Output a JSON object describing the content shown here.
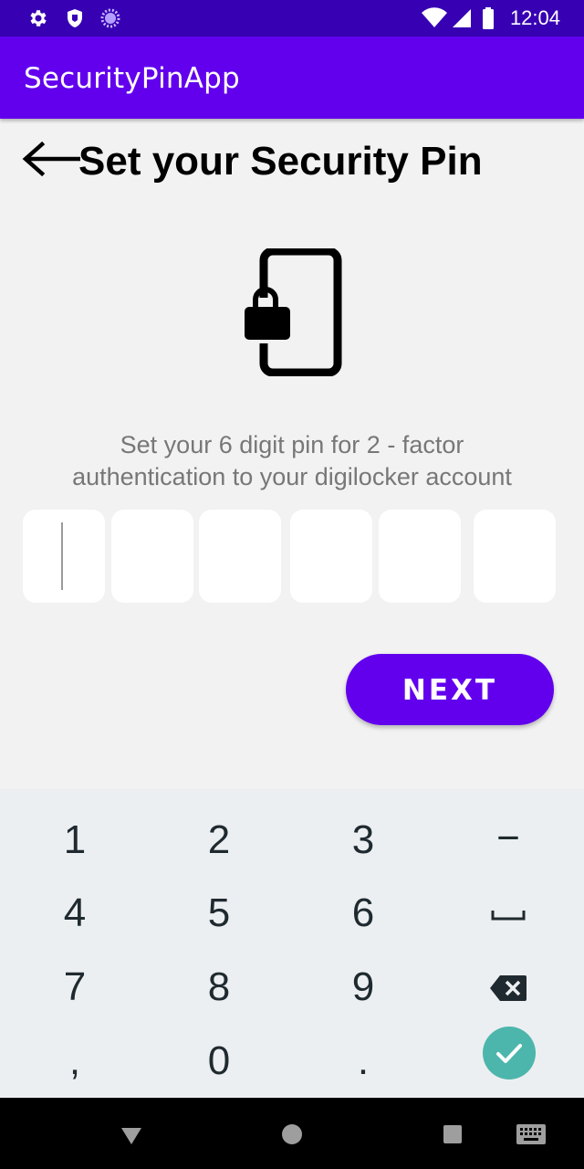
{
  "status_bar": {
    "time": "12:04",
    "icons": [
      "settings-gear-icon",
      "shield-icon",
      "sync-spinner-icon",
      "wifi-icon",
      "cell-signal-icon",
      "battery-icon"
    ]
  },
  "app_bar": {
    "title": "SecurityPinApp",
    "color": "#6200ee",
    "status_color": "#3700b3"
  },
  "header": {
    "back_icon": "arrow-back-icon",
    "title": "Set your Security Pin"
  },
  "illustration": {
    "icon": "phone-lock-icon"
  },
  "instruction": {
    "line1": "Set your 6 digit pin for 2 - factor",
    "line2": "authentication to your digilocker account"
  },
  "pin": {
    "length": 6,
    "values": [
      "",
      "",
      "",
      "",
      "",
      ""
    ],
    "focused_index": 0
  },
  "next_button": {
    "label": "NEXT"
  },
  "keypad": {
    "rows": [
      [
        "1",
        "2",
        "3",
        "−"
      ],
      [
        "4",
        "5",
        "6",
        "space"
      ],
      [
        "7",
        "8",
        "9",
        "backspace"
      ],
      [
        ",",
        "0",
        ".",
        "done"
      ]
    ],
    "minus_label": "−",
    "done_color": "#4db6ac"
  },
  "nav_bar": {
    "buttons": [
      "back-triangle-icon",
      "home-circle-icon",
      "recents-square-icon",
      "keyboard-icon"
    ]
  }
}
